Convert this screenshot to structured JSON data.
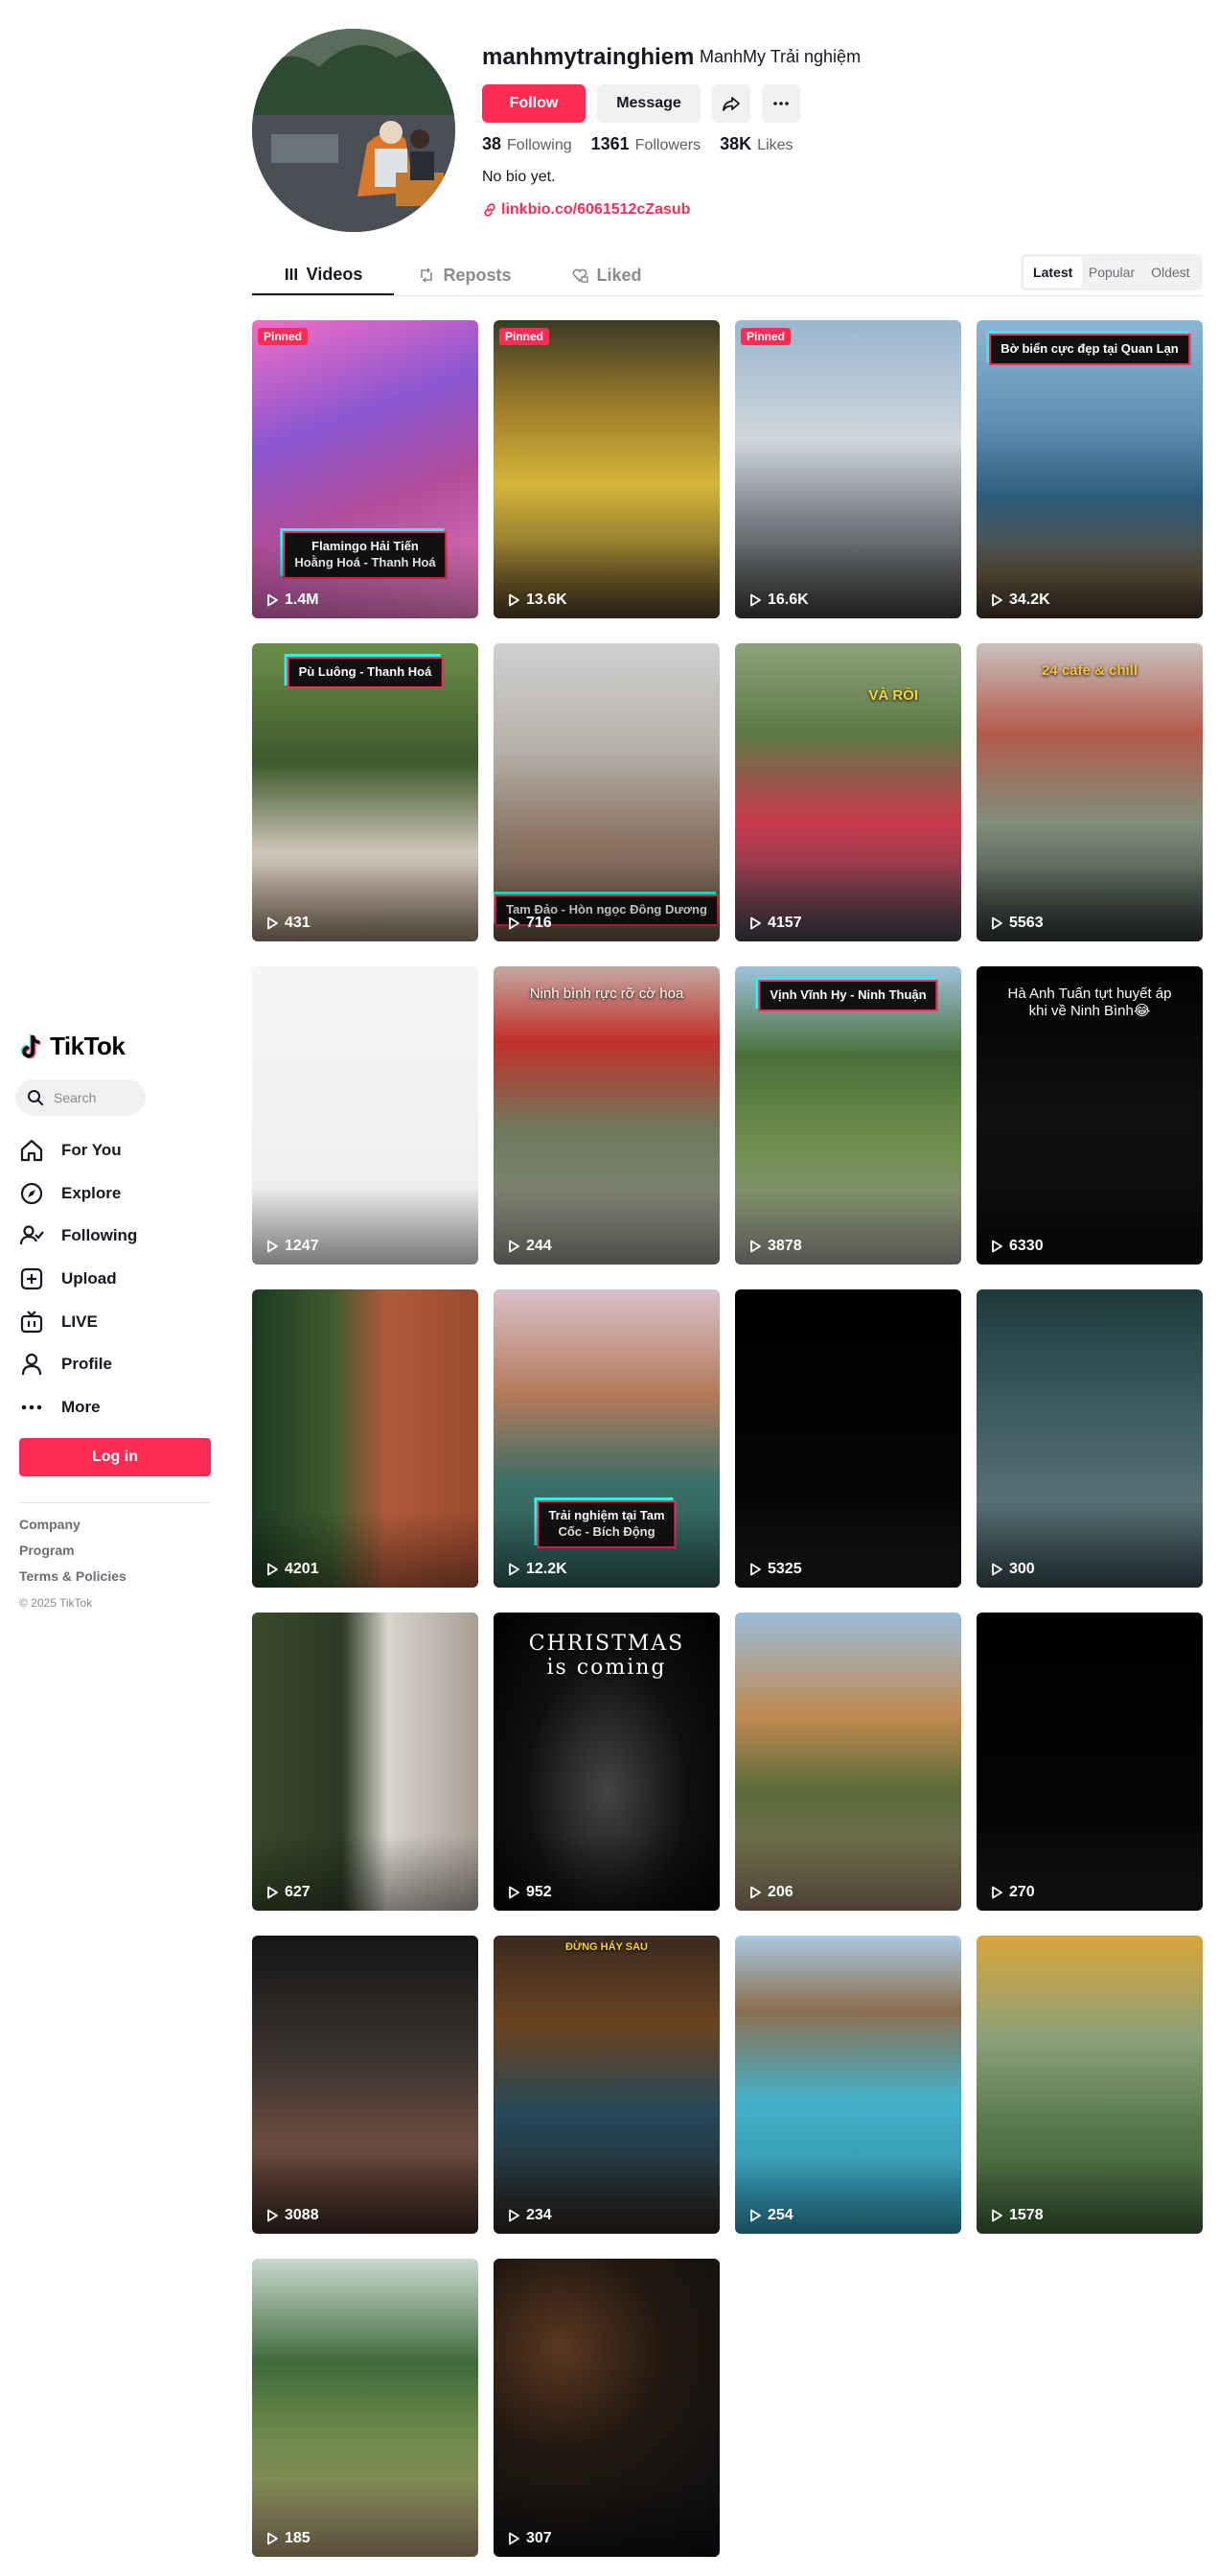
{
  "sidebar": {
    "logo_text": "TikTok",
    "search_placeholder": "Search",
    "nav": [
      {
        "label": "For You",
        "icon": "home-icon"
      },
      {
        "label": "Explore",
        "icon": "compass-icon"
      },
      {
        "label": "Following",
        "icon": "following-icon"
      },
      {
        "label": "Upload",
        "icon": "upload-icon"
      },
      {
        "label": "LIVE",
        "icon": "live-icon"
      },
      {
        "label": "Profile",
        "icon": "profile-icon"
      },
      {
        "label": "More",
        "icon": "more-icon"
      }
    ],
    "login_label": "Log in",
    "footer_links": [
      "Company",
      "Program",
      "Terms & Policies"
    ],
    "copyright": "© 2025 TikTok"
  },
  "profile": {
    "username": "manhmytrainghiem",
    "nickname": "ManhMy Trải nghiệm",
    "follow_label": "Follow",
    "message_label": "Message",
    "stats": {
      "following": "38",
      "following_label": "Following",
      "followers": "1361",
      "followers_label": "Followers",
      "likes": "38K",
      "likes_label": "Likes"
    },
    "bio": "No bio yet.",
    "link": "linkbio.co/6061512cZasub"
  },
  "tabs": [
    {
      "label": "Videos",
      "icon": "grid-icon",
      "active": true
    },
    {
      "label": "Reposts",
      "icon": "repost-icon",
      "active": false
    },
    {
      "label": "Liked",
      "icon": "heart-lock-icon",
      "active": false
    }
  ],
  "sort": [
    "Latest",
    "Popular",
    "Oldest"
  ],
  "videos": [
    {
      "views": "1.4M",
      "pinned": "Pinned",
      "caption": "Flamingo Hải Tiến\nHoằng Hoá - Thanh Hoá",
      "bg": "pink-cafe"
    },
    {
      "views": "13.6K",
      "pinned": "Pinned",
      "bg": "lantern-street"
    },
    {
      "views": "16.6K",
      "pinned": "Pinned",
      "bg": "selfie-city"
    },
    {
      "views": "34.2K",
      "caption": "Bờ biển cực đẹp tại Quan Lạn",
      "bg": "coast"
    },
    {
      "views": "431",
      "caption": "Pù Luông - Thanh Hoá",
      "bg": "window-green"
    },
    {
      "views": "716",
      "caption": "Tam Đảo - Hòn ngọc Đông Dương",
      "bg": "mountain-cafe"
    },
    {
      "views": "4157",
      "overtext": "VÀ RỒI",
      "bg": "picnic"
    },
    {
      "views": "5563",
      "overtext": "24 cafe & chill",
      "bg": "lake-house"
    },
    {
      "views": "1247",
      "bg": "blank-white"
    },
    {
      "views": "244",
      "overtext": "Ninh bình rực rỡ cờ hoa",
      "bg": "flags-street"
    },
    {
      "views": "3878",
      "caption": "Vịnh Vĩnh Hy - Ninh Thuận",
      "bg": "hills"
    },
    {
      "views": "6330",
      "overtext": "Hà Anh Tuấn tựt huyết áp\nkhi về Ninh Bình😂",
      "bg": "concert"
    },
    {
      "views": "4201",
      "bg": "brick-vine"
    },
    {
      "views": "12.2K",
      "caption": "Trải nghiệm tại Tam\nCốc - Bích Động",
      "bg": "river-temple"
    },
    {
      "views": "5325",
      "bg": "black"
    },
    {
      "views": "300",
      "bg": "blur-teal"
    },
    {
      "views": "627",
      "bg": "christmas-kaws"
    },
    {
      "views": "952",
      "overtext": "CHRISTMAS\nis coming",
      "bg": "xmas-tree"
    },
    {
      "views": "206",
      "bg": "cham-tower"
    },
    {
      "views": "270",
      "bg": "black"
    },
    {
      "views": "3088",
      "bg": "rain-garden"
    },
    {
      "views": "234",
      "overtext": "ĐỪNG HÁY SAU",
      "bg": "night-lantern"
    },
    {
      "views": "254",
      "bg": "pool"
    },
    {
      "views": "1578",
      "bg": "pagoda-sunset"
    },
    {
      "views": "185",
      "bg": "field-table"
    },
    {
      "views": "307",
      "bg": "bokeh-dark"
    }
  ]
}
